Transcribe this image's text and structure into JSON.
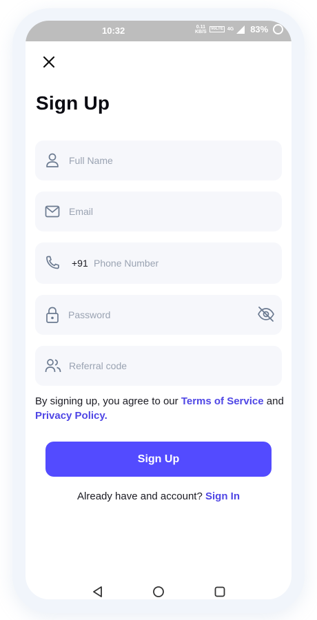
{
  "status_bar": {
    "time": "10:32",
    "speed_value": "0.11",
    "speed_unit": "KB/S",
    "volte": "VoLTE",
    "network": "4G",
    "battery": "83%"
  },
  "header": {
    "close_icon": "close-icon",
    "title": "Sign Up"
  },
  "form": {
    "full_name": {
      "placeholder": "Full Name",
      "icon": "user-icon"
    },
    "email": {
      "placeholder": "Email",
      "icon": "mail-icon"
    },
    "phone": {
      "prefix": "+91",
      "placeholder": "Phone Number",
      "icon": "phone-icon"
    },
    "password": {
      "placeholder": "Password",
      "icon": "lock-icon",
      "toggle_icon": "eye-off-icon"
    },
    "referral": {
      "placeholder": "Referral code",
      "icon": "users-icon"
    }
  },
  "terms": {
    "prefix": "By signing up, you agree to our ",
    "terms_link": "Terms of Service",
    "middle": " and",
    "privacy_link": "Privacy Policy."
  },
  "actions": {
    "signup_button": "Sign Up",
    "have_account_text": "Already have and account? ",
    "signin_link": "Sign In"
  },
  "nav_bar": {
    "back_icon": "triangle-back-icon",
    "home_icon": "circle-home-icon",
    "recents_icon": "square-recents-icon"
  },
  "colors": {
    "accent": "#534BFF",
    "link": "#4F46E5",
    "field_bg": "#F6F7FB",
    "icon": "#6B7A90"
  }
}
